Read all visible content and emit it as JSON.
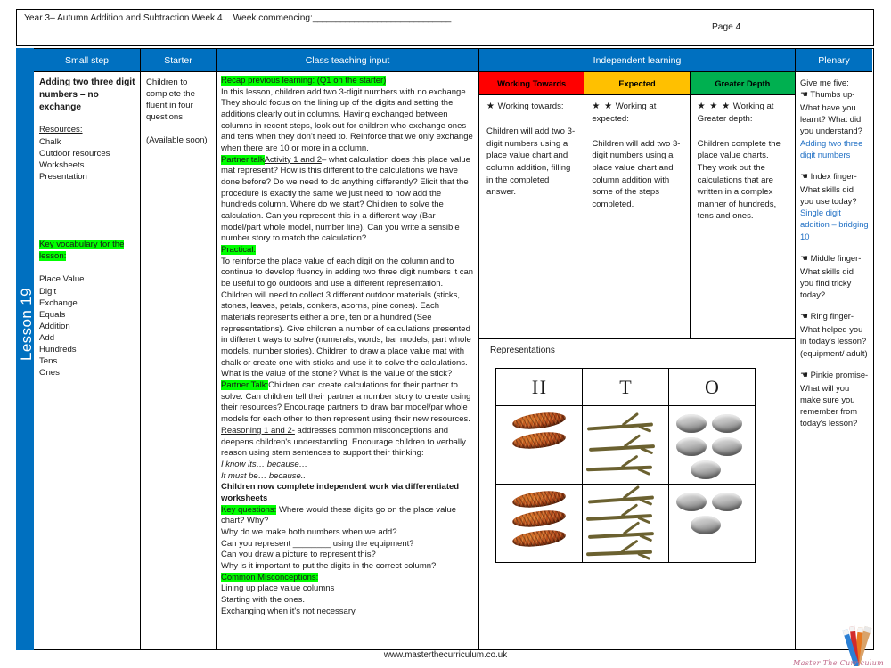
{
  "header": {
    "title": "Year 3– Autumn Addition and Subtraction Week 4",
    "week_commencing_label": "Week commencing:",
    "week_commencing_rule": "______________________________",
    "page": "Page 4"
  },
  "spine": {
    "lesson_label": "Lesson 19"
  },
  "columns": {
    "small_step": "Small step",
    "starter": "Starter",
    "class_teaching_input": "Class teaching input",
    "independent_learning": "Independent learning",
    "plenary": "Plenary"
  },
  "small_step": {
    "title": "Adding two three digit numbers – no exchange",
    "resources_heading": "Resources:",
    "resources": [
      "Chalk",
      "Outdoor resources",
      "Worksheets",
      "Presentation"
    ],
    "key_vocab_heading": "Key vocabulary for the lesson:",
    "key_vocab": [
      "Place Value",
      "Digit",
      "Exchange",
      "Equals",
      "Addition",
      "Add",
      "Hundreds",
      "Tens",
      "Ones"
    ]
  },
  "starter": {
    "text": "Children to complete the fluent in four questions.",
    "availability": "(Available soon)"
  },
  "teaching": {
    "recap_heading": "Recap previous learning: (Q1 on the starter)",
    "recap_body": "In this lesson, children add two 3-digit numbers with no exchange. They should focus on the lining up of the digits and setting the additions clearly out in columns. Having exchanged between columns in recent steps, look out for children who exchange ones and tens when they don't need to. Reinforce that we only exchange when there are 10 or more in a column.",
    "partner_talk_1_label": "Partner talk",
    "partner_talk_1_activity": "Activity 1 and 2",
    "partner_talk_1_body": "– what calculation does this place value mat represent?  How is this different to the calculations we have done before?  Do we need to do anything differently?  Elicit that the procedure is exactly the same we just need to now add the hundreds column. Where do we start?  Children to solve the calculation.  Can you represent this in a different way  (Bar model/part whole model, number line).  Can you write a sensible number story to match the calculation?",
    "practical_heading": "Practical:",
    "practical_body": "To reinforce the place value of each digit on the column and to continue to develop fluency in adding two three digit numbers it can be useful to go outdoors and use a different representation. Children will need to collect 3 different outdoor materials (sticks, stones, leaves, petals, conkers, acorns, pine cones).  Each materials represents either a one, ten or a hundred (See representations). Give children a number of calculations presented in different ways to solve (numerals, words, bar models, part whole models, number stories). Children to draw a place value mat with chalk or create one with sticks and use it to solve the calculations.  What is the value of the stone?  What is the value of the stick?",
    "partner_talk_2_label": "Partner Talk:",
    "partner_talk_2_body": "Children can create calculations for their partner to solve.  Can children tell their partner a number story to create using their resources?  Encourage partners  to draw bar model/par whole models  for each other to then represent using their new resources.",
    "reasoning_label": "Reasoning 1 and 2-",
    "reasoning_body": " addresses common misconceptions and deepens children's understanding.  Encourage children to verbally reason using stem sentences to support their thinking:",
    "stem_1": "I know its… because…",
    "stem_2": "It must be… because..",
    "independent_note": "Children now complete independent work via differentiated worksheets",
    "key_questions_heading": "Key questions:",
    "key_questions": [
      " Where would these digits go on the place value chart? Why?",
      "Why do we make both numbers when we add?",
      "Can you represent ________ using the equipment?",
      "Can you draw a picture to represent this?",
      "Why is it important to put the digits in the correct column?"
    ],
    "misconceptions_heading": "Common Misconceptions:",
    "misconceptions": [
      "Lining up place value columns",
      "Starting with the ones.",
      "Exchanging when it's not necessary"
    ]
  },
  "independent": {
    "levels": [
      {
        "label": "Working Towards",
        "color": "#FF0000",
        "stars": "★",
        "heading": "Working towards:",
        "text": "Children will add two 3-digit numbers using a place value chart and column addition, filling in the completed answer."
      },
      {
        "label": "Expected",
        "color": "#FFC000",
        "stars": "★ ★",
        "heading": "Working at expected:",
        "text": "Children will add two 3-digit numbers using a place value chart and column addition with some of the steps completed."
      },
      {
        "label": "Greater Depth",
        "color": "#00B050",
        "stars": "★ ★ ★",
        "heading": "Working at Greater depth:",
        "text": "Children complete the place value charts. They work out the calculations that are written in a complex manner of hundreds, tens and ones."
      }
    ]
  },
  "representations": {
    "title": "Representations",
    "headers": [
      "H",
      "T",
      "O"
    ],
    "rows": [
      {
        "hundreds": 2,
        "tens": 3,
        "ones": 5
      },
      {
        "hundreds": 3,
        "tens": 4,
        "ones": 3
      }
    ],
    "hundreds_material": "pine-cone",
    "tens_material": "stick",
    "ones_material": "stone"
  },
  "plenary": {
    "intro": "Give me five:",
    "items": [
      {
        "icon": "hand-icon",
        "text": "Thumbs up- What have you learnt? What did you understand?",
        "answer": "Adding two three digit numbers"
      },
      {
        "icon": "hand-icon",
        "text": "Index finger- What skills did you use today?",
        "answer": "Single digit addition – bridging 10"
      },
      {
        "icon": "hand-icon",
        "text": "Middle finger- What skills did you find tricky today?",
        "answer": ""
      },
      {
        "icon": "hand-icon",
        "text": "Ring finger- What helped you in today's lesson? (equipment/ adult)",
        "answer": ""
      },
      {
        "icon": "hand-icon",
        "text": "Pinkie promise- What will you make sure you remember from today's lesson?",
        "answer": ""
      }
    ]
  },
  "footer": {
    "url": "www.masterthecurriculum.co.uk",
    "logo_script": "Master The Curriculum"
  }
}
